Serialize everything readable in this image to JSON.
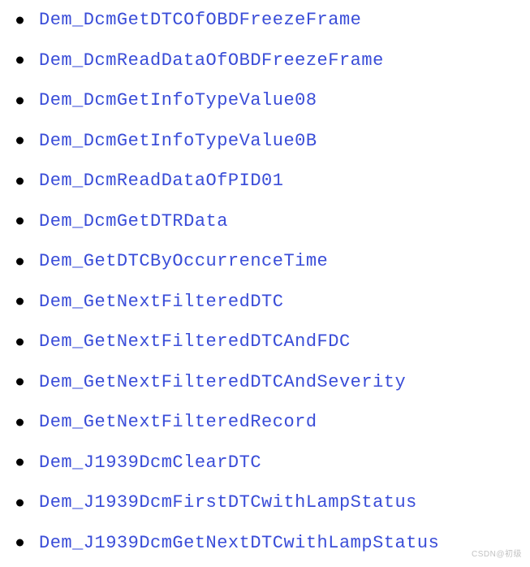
{
  "list": {
    "items": [
      {
        "label": "Dem_DcmGetDTCOfOBDFreezeFrame"
      },
      {
        "label": "Dem_DcmReadDataOfOBDFreezeFrame"
      },
      {
        "label": "Dem_DcmGetInfoTypeValue08"
      },
      {
        "label": "Dem_DcmGetInfoTypeValue0B"
      },
      {
        "label": "Dem_DcmReadDataOfPID01"
      },
      {
        "label": "Dem_DcmGetDTRData"
      },
      {
        "label": "Dem_GetDTCByOccurrenceTime"
      },
      {
        "label": "Dem_GetNextFilteredDTC"
      },
      {
        "label": "Dem_GetNextFilteredDTCAndFDC"
      },
      {
        "label": "Dem_GetNextFilteredDTCAndSeverity"
      },
      {
        "label": "Dem_GetNextFilteredRecord"
      },
      {
        "label": "Dem_J1939DcmClearDTC"
      },
      {
        "label": "Dem_J1939DcmFirstDTCwithLampStatus"
      },
      {
        "label": "Dem_J1939DcmGetNextDTCwithLampStatus"
      }
    ]
  },
  "watermark": "CSDN@初级"
}
